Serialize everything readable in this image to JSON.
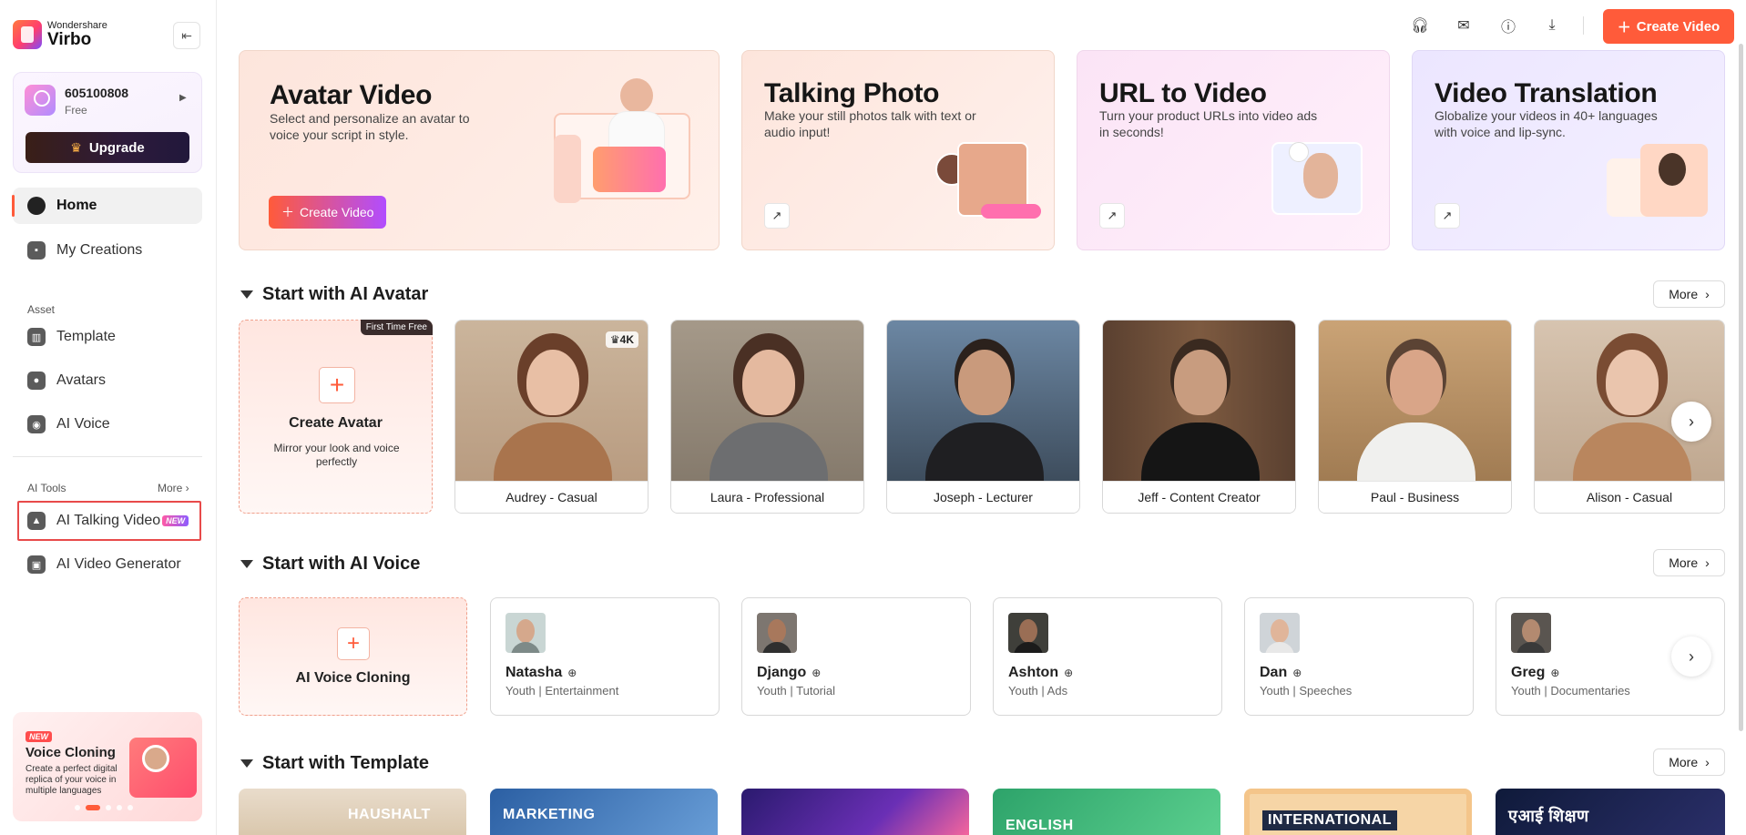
{
  "brand": {
    "small": "Wondershare",
    "big": "Virbo"
  },
  "user": {
    "id": "605100808",
    "plan": "Free",
    "upgrade_label": "Upgrade"
  },
  "nav": {
    "home": "Home",
    "my_creations": "My Creations",
    "asset_label": "Asset",
    "template": "Template",
    "avatars": "Avatars",
    "ai_voice": "AI Voice",
    "ai_tools_label": "AI Tools",
    "more": "More",
    "ai_talking_video": "AI Talking Video",
    "new_badge": "NEW",
    "ai_video_generator": "AI Video Generator"
  },
  "promo": {
    "new_badge": "NEW",
    "title": "Voice Cloning",
    "desc": "Create a perfect digital replica of your voice in multiple languages"
  },
  "topbar": {
    "create_label": "Create Video"
  },
  "features": [
    {
      "title": "Avatar Video",
      "desc": "Select and personalize an avatar to voice your script in style.",
      "button": "Create Video"
    },
    {
      "title": "Talking Photo",
      "desc": "Make your still photos talk with text or audio input!"
    },
    {
      "title": "URL to Video",
      "desc": "Turn your product URLs into video ads in seconds!"
    },
    {
      "title": "Video Translation",
      "desc": "Globalize your videos in 40+ languages with voice and lip-sync."
    }
  ],
  "sections": {
    "avatar": "Start with AI Avatar",
    "voice": "Start with AI Voice",
    "template": "Start with Template",
    "more": "More"
  },
  "create_avatar": {
    "badge": "First Time Free",
    "title": "Create Avatar",
    "desc": "Mirror your look and voice perfectly"
  },
  "avatars": [
    {
      "name": "Audrey - Casual",
      "badge": "4K"
    },
    {
      "name": "Laura - Professional"
    },
    {
      "name": "Joseph - Lecturer"
    },
    {
      "name": "Jeff - Content Creator"
    },
    {
      "name": "Paul - Business"
    },
    {
      "name": "Alison - Casual"
    }
  ],
  "voice_clone": {
    "title": "AI Voice Cloning"
  },
  "voices": [
    {
      "name": "Natasha",
      "tag": "Youth | Entertainment"
    },
    {
      "name": "Django",
      "tag": "Youth | Tutorial"
    },
    {
      "name": "Ashton",
      "tag": "Youth | Ads"
    },
    {
      "name": "Dan",
      "tag": "Youth | Speeches"
    },
    {
      "name": "Greg",
      "tag": "Youth | Documentaries"
    }
  ],
  "templates": [
    {
      "text": "HAUSHALT"
    },
    {
      "text": "MARKETING"
    },
    {
      "text": ""
    },
    {
      "text": "ENGLISH"
    },
    {
      "text": "INTERNATIONAL"
    },
    {
      "text": "एआई शिक्षण"
    }
  ],
  "colors": {
    "accent": "#ff5b3a",
    "highlight": "#e84a4a"
  }
}
